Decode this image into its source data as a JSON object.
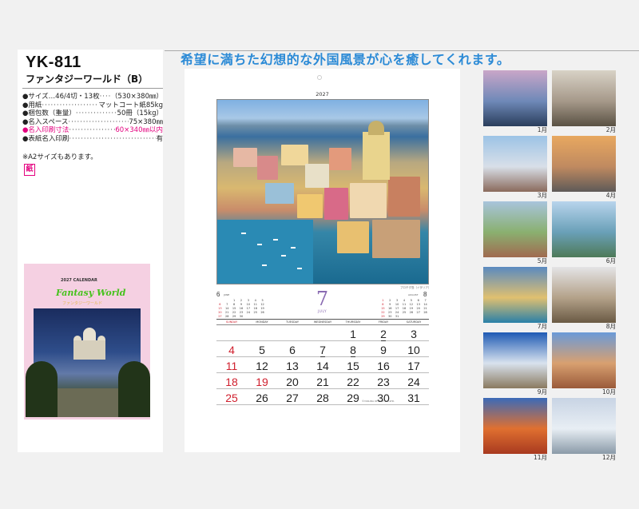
{
  "headline": "希望に満ちた幻想的な外国風景が心を癒してくれます。",
  "product": {
    "code": "YK-811",
    "name": "ファンタジーワールド（B）",
    "specs": [
      {
        "label": "●サイズ…46/4切・13枚",
        "value": "（530×380㎜）",
        "pink": false
      },
      {
        "label": "●用紙",
        "value": "マットコート紙85kg",
        "pink": false
      },
      {
        "label": "●梱包数（重量）",
        "value": "50冊（15kg）",
        "pink": false
      },
      {
        "label": "●名入スペース",
        "value": "75×380㎜",
        "pink": false
      },
      {
        "label": "●名入印刷寸法",
        "value": "60×340㎜以内",
        "pink": true
      },
      {
        "label": "●表紙名入印刷",
        "value": "有",
        "pink": false
      }
    ],
    "note": "※A2サイズもあります。",
    "paper_badge": "紙"
  },
  "cover": {
    "title": "2027 CALENDAR",
    "logo": "Fantasy World",
    "subtitle": "ファンタジーワールド"
  },
  "sheet": {
    "year": "2027",
    "month_number": "7",
    "month_name": "JULY",
    "caption": "プロチダ島（イタリア）",
    "prev_month": {
      "number": "6",
      "name": "JUNE",
      "cells": [
        "",
        "",
        "1",
        "2",
        "3",
        "4",
        "5",
        "6",
        "7",
        "8",
        "9",
        "10",
        "11",
        "12",
        "13",
        "14",
        "15",
        "16",
        "17",
        "18",
        "19",
        "20",
        "21",
        "22",
        "23",
        "24",
        "25",
        "26",
        "27",
        "28",
        "29",
        "30",
        "",
        "",
        ""
      ]
    },
    "next_month": {
      "number": "8",
      "name": "AUGUST",
      "cells": [
        "1",
        "2",
        "3",
        "4",
        "5",
        "6",
        "7",
        "8",
        "9",
        "10",
        "11",
        "12",
        "13",
        "14",
        "15",
        "16",
        "17",
        "18",
        "19",
        "20",
        "21",
        "22",
        "23",
        "24",
        "25",
        "26",
        "27",
        "28",
        "29",
        "30",
        "31",
        "",
        "",
        "",
        ""
      ]
    },
    "weekdays": [
      "SUNDAY",
      "MONDAY",
      "TUESDAY",
      "WEDNESDAY",
      "THURSDAY",
      "FRIDAY",
      "SATURDAY"
    ],
    "weeks": [
      [
        "",
        "",
        "",
        "",
        "1",
        "2",
        "3"
      ],
      [
        "4",
        "5",
        "6",
        "7",
        "8",
        "9",
        "10"
      ],
      [
        "11",
        "12",
        "13",
        "14",
        "15",
        "16",
        "17"
      ],
      [
        "18",
        "19",
        "20",
        "21",
        "22",
        "23",
        "24"
      ],
      [
        "25",
        "26",
        "27",
        "28",
        "29",
        "30",
        "31"
      ]
    ],
    "holiday_days": [
      "19"
    ],
    "fine_print": "©YASUDA OFFSET CO.,LTD."
  },
  "thumbnails": [
    {
      "label": "1月",
      "colors": [
        "#c9a6c8",
        "#6f89b8",
        "#2a3e5c"
      ]
    },
    {
      "label": "2月",
      "colors": [
        "#d8d2c6",
        "#a6998a",
        "#5a5244"
      ]
    },
    {
      "label": "3月",
      "colors": [
        "#9cc3e6",
        "#d8dfe8",
        "#8a6a5c"
      ]
    },
    {
      "label": "4月",
      "colors": [
        "#e8a860",
        "#c08a60",
        "#5e5a58"
      ]
    },
    {
      "label": "5月",
      "colors": [
        "#a8c4dc",
        "#8ab070",
        "#a06a50"
      ]
    },
    {
      "label": "6月",
      "colors": [
        "#b8d4ec",
        "#6aa0b8",
        "#4e7a58"
      ]
    },
    {
      "label": "7月",
      "colors": [
        "#5a8ac0",
        "#e0c070",
        "#2a80a8"
      ]
    },
    {
      "label": "8月",
      "colors": [
        "#e4e4e6",
        "#b4a28a",
        "#6a5a44"
      ]
    },
    {
      "label": "9月",
      "colors": [
        "#1e5ab4",
        "#d8e2ee",
        "#8a7a60"
      ]
    },
    {
      "label": "10月",
      "colors": [
        "#6a9ad8",
        "#d8a070",
        "#9a5a3a"
      ]
    },
    {
      "label": "11月",
      "colors": [
        "#3a6ab8",
        "#e07030",
        "#a83a20"
      ]
    },
    {
      "label": "12月",
      "colors": [
        "#c8d4e4",
        "#e8eef4",
        "#8a9aa8"
      ]
    }
  ]
}
